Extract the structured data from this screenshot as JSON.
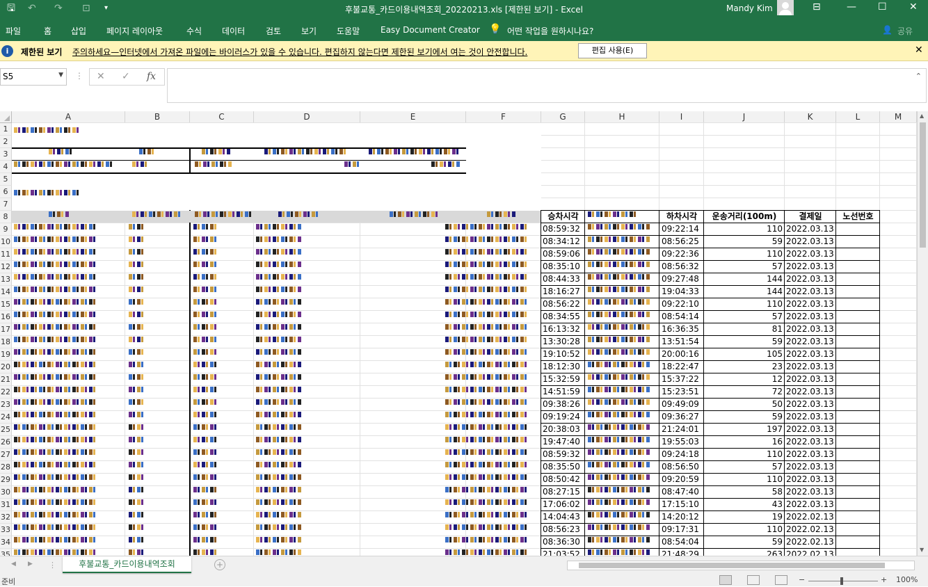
{
  "titlebar": {
    "title": "후불교통_카드이용내역조회_20220213.xls  [제한된 보기]  -  Excel",
    "user": "Mandy Kim",
    "save_icon": "save-icon",
    "minimize": "—",
    "restore": "❐",
    "maximize": "☐",
    "close": "✕"
  },
  "menu": {
    "items": [
      "파일",
      "홈",
      "삽입",
      "페이지 레이아웃",
      "수식",
      "데이터",
      "검토",
      "보기",
      "도움말",
      "Easy Document Creator"
    ],
    "tell": "어떤 작업을 원하시나요?",
    "share": "공유"
  },
  "message": {
    "title": "제한된 보기",
    "text": "주의하세요—인터넷에서 가져온 파일에는 바이러스가 있을 수 있습니다. 편집하지 않는다면 제한된 보기에서 여는 것이 안전합니다.",
    "button": "편집 사용(E)"
  },
  "formula": {
    "namebox": "S5",
    "fx": "fx",
    "value": ""
  },
  "grid": {
    "columns": [
      "A",
      "B",
      "C",
      "D",
      "E",
      "F",
      "G",
      "H",
      "I",
      "J",
      "K",
      "L",
      "M"
    ],
    "rows": [
      "1",
      "2",
      "3",
      "4",
      "5",
      "6",
      "7",
      "8",
      "9",
      "10",
      "11",
      "12",
      "13",
      "14",
      "15",
      "16",
      "17",
      "18",
      "19",
      "20",
      "21",
      "22",
      "23",
      "24",
      "25",
      "26",
      "27",
      "28",
      "29",
      "30",
      "31",
      "32",
      "33",
      "34",
      "35"
    ],
    "header_g": "승차시각",
    "header_i": "하차시각",
    "header_j": "운송거리(100m)",
    "header_k": "결제일",
    "header_l": "노선번호",
    "table": [
      [
        "08:59:32",
        "09:22:14",
        "110",
        "2022.03.13"
      ],
      [
        "08:34:12",
        "08:56:25",
        "59",
        "2022.03.13"
      ],
      [
        "08:59:06",
        "09:22:36",
        "110",
        "2022.03.13"
      ],
      [
        "08:35:10",
        "08:56:32",
        "57",
        "2022.03.13"
      ],
      [
        "08:44:33",
        "09:27:48",
        "144",
        "2022.03.13"
      ],
      [
        "18:16:27",
        "19:04:33",
        "144",
        "2022.03.13"
      ],
      [
        "08:56:22",
        "09:22:10",
        "110",
        "2022.03.13"
      ],
      [
        "08:34:55",
        "08:54:14",
        "57",
        "2022.03.13"
      ],
      [
        "16:13:32",
        "16:36:35",
        "81",
        "2022.03.13"
      ],
      [
        "13:30:28",
        "13:51:54",
        "59",
        "2022.03.13"
      ],
      [
        "19:10:52",
        "20:00:16",
        "105",
        "2022.03.13"
      ],
      [
        "18:12:30",
        "18:22:47",
        "23",
        "2022.03.13"
      ],
      [
        "15:32:59",
        "15:37:22",
        "12",
        "2022.03.13"
      ],
      [
        "14:51:59",
        "15:23:51",
        "72",
        "2022.03.13"
      ],
      [
        "09:38:26",
        "09:49:09",
        "50",
        "2022.03.13"
      ],
      [
        "09:19:24",
        "09:36:27",
        "59",
        "2022.03.13"
      ],
      [
        "20:38:03",
        "21:24:01",
        "197",
        "2022.03.13"
      ],
      [
        "19:47:40",
        "19:55:03",
        "16",
        "2022.03.13"
      ],
      [
        "08:59:32",
        "09:24:18",
        "110",
        "2022.03.13"
      ],
      [
        "08:35:50",
        "08:56:50",
        "57",
        "2022.03.13"
      ],
      [
        "08:50:42",
        "09:20:59",
        "110",
        "2022.03.13"
      ],
      [
        "08:27:15",
        "08:47:40",
        "58",
        "2022.03.13"
      ],
      [
        "17:06:02",
        "17:15:10",
        "43",
        "2022.03.13"
      ],
      [
        "14:04:43",
        "14:20:12",
        "19",
        "2022.02.13"
      ],
      [
        "08:56:23",
        "09:17:31",
        "110",
        "2022.02.13"
      ],
      [
        "08:36:30",
        "08:54:04",
        "59",
        "2022.02.13"
      ],
      [
        "21:03:52",
        "21:48:29",
        "263",
        "2022.02.13"
      ]
    ]
  },
  "sheet": {
    "tab": "후불교통_카드이용내역조회",
    "status": "준비",
    "zoom": "100%"
  }
}
